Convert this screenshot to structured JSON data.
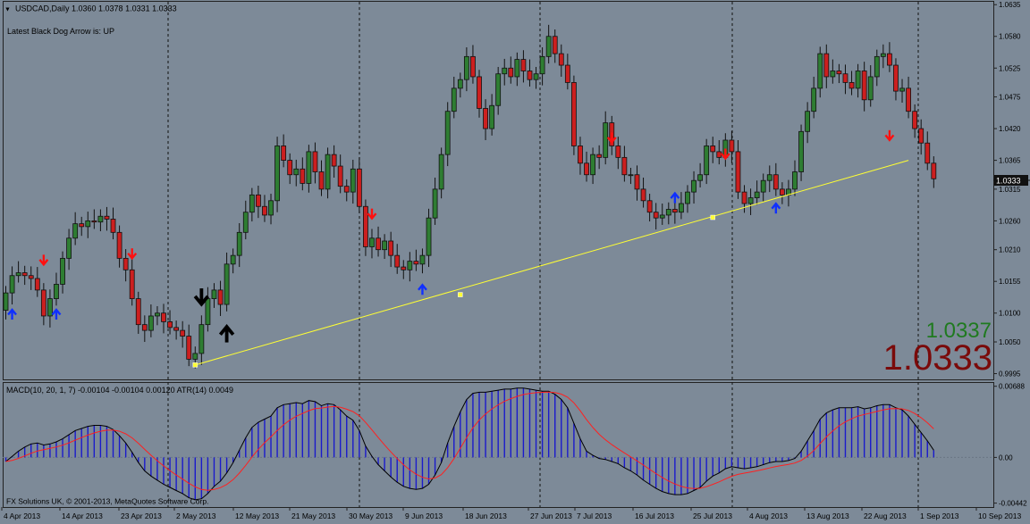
{
  "header": {
    "symbol_line": "USDCAD,Daily  1.0360 1.0378 1.0331 1.0333",
    "indicator_line": "Latest Black Dog Arrow is:  UP"
  },
  "price_display": {
    "bid": "1.0337",
    "current": "1.0333",
    "current_label": "1.0333"
  },
  "macd_header": "MACD(10, 20, 1, 7) -0.00104 -0.00104 0.00120  ATR(14) 0.0049",
  "copyright": "FX Solutions UK, © 2001-2013, MetaQuotes Software Corp.",
  "colors": {
    "background": "#7d8a98",
    "bull_candle": "#2e7d32",
    "bear_candle": "#cc1f1f",
    "macd_hist": "#1a1acc",
    "signal_line": "#ff2020",
    "trendline": "#ffff33",
    "up_arrow": "#1030ff",
    "down_arrow": "#ff1010",
    "black_arrow": "#000000"
  },
  "chart_data": {
    "type": "candlestick",
    "price_ticks": [
      "1.0635",
      "1.0580",
      "1.0525",
      "1.0475",
      "1.0420",
      "1.0365",
      "1.0315",
      "1.0260",
      "1.0210",
      "1.0155",
      "1.0100",
      "1.0050",
      "0.9995"
    ],
    "macd_ticks": [
      "0.00688",
      "0.00",
      "-0.00442"
    ],
    "date_labels": [
      "4 Apr 2013",
      "14 Apr 2013",
      "23 Apr 2013",
      "2 May 2013",
      "12 May 2013",
      "21 May 2013",
      "30 May 2013",
      "9 Jun 2013",
      "18 Jun 2013",
      "27 Jun 2013",
      "7 Jul 2013",
      "16 Jul 2013",
      "25 Jul 2013",
      "4 Aug 2013",
      "13 Aug 2013",
      "22 Aug 2013",
      "1 Sep 2013",
      "10 Sep 2013"
    ],
    "ylim": [
      0.9985,
      1.064
    ],
    "macd_ylim": [
      -0.0048,
      0.0072
    ],
    "closes": [
      1.0135,
      1.0165,
      1.017,
      1.0165,
      1.016,
      1.014,
      1.0095,
      1.0125,
      1.015,
      1.0195,
      1.023,
      1.0255,
      1.025,
      1.026,
      1.0258,
      1.0268,
      1.0263,
      1.024,
      1.0195,
      1.0175,
      1.0125,
      1.008,
      1.007,
      1.0095,
      1.01,
      1.0085,
      1.0075,
      1.007,
      1.006,
      1.002,
      1.003,
      1.008,
      1.0125,
      1.014,
      1.0115,
      1.0185,
      1.02,
      1.024,
      1.0275,
      1.0305,
      1.0285,
      1.027,
      1.0295,
      1.039,
      1.0365,
      1.034,
      1.035,
      1.0325,
      1.038,
      1.0345,
      1.0315,
      1.0375,
      1.0355,
      1.032,
      1.031,
      1.035,
      1.0285,
      1.0215,
      1.023,
      1.021,
      1.0225,
      1.02,
      1.018,
      1.0175,
      1.019,
      1.0185,
      1.02,
      1.0265,
      1.0315,
      1.0375,
      1.045,
      1.049,
      1.0505,
      1.0545,
      1.051,
      1.0455,
      1.042,
      1.046,
      1.0515,
      1.0525,
      1.051,
      1.054,
      1.052,
      1.0505,
      1.0515,
      1.0545,
      1.058,
      1.055,
      1.053,
      1.05,
      1.039,
      1.036,
      1.034,
      1.0375,
      1.037,
      1.043,
      1.039,
      1.037,
      1.034,
      1.034,
      1.0315,
      1.0295,
      1.0275,
      1.0265,
      1.027,
      1.028,
      1.0275,
      1.029,
      1.031,
      1.033,
      1.034,
      1.039,
      1.038,
      1.037,
      1.04,
      1.038,
      1.031,
      1.029,
      1.03,
      1.031,
      1.033,
      1.034,
      1.0315,
      1.0305,
      1.0315,
      1.0345,
      1.0415,
      1.045,
      1.049,
      1.055,
      1.051,
      1.052,
      1.0515,
      1.05,
      1.049,
      1.052,
      1.047,
      1.051,
      1.0545,
      1.055,
      1.053,
      1.0485,
      1.049,
      1.045,
      1.042,
      1.0395,
      1.036,
      1.0333
    ],
    "open_first": 1.0105,
    "trendline": {
      "start": {
        "index": 30,
        "price": 1.001
      },
      "end": {
        "index": 143,
        "price": 1.0365
      }
    },
    "trendline_markers": [
      {
        "index": 72,
        "price": 1.0132
      },
      {
        "index": 112,
        "price": 1.0266
      }
    ],
    "up_arrows": [
      {
        "index": 1,
        "price": 1.0098
      },
      {
        "index": 8,
        "price": 1.0098
      },
      {
        "index": 66,
        "price": 1.0141
      },
      {
        "index": 106,
        "price": 1.03
      },
      {
        "index": 122,
        "price": 1.0282
      }
    ],
    "down_arrows": [
      {
        "index": 6,
        "price": 1.0192
      },
      {
        "index": 20,
        "price": 1.0203
      },
      {
        "index": 58,
        "price": 1.0272
      },
      {
        "index": 96,
        "price": 1.0404
      },
      {
        "index": 114,
        "price": 1.0376
      },
      {
        "index": 140,
        "price": 1.0408
      }
    ],
    "black_up_arrows": [
      {
        "index": 35,
        "price": 1.0064
      }
    ],
    "black_down_arrows": [
      {
        "index": 31,
        "price": 1.0128
      }
    ],
    "macd": [
      -0.0004,
      0.0001,
      0.0006,
      0.001,
      0.0013,
      0.0014,
      0.0012,
      0.0013,
      0.0015,
      0.0018,
      0.0022,
      0.0026,
      0.0028,
      0.003,
      0.0031,
      0.0031,
      0.003,
      0.0027,
      0.0021,
      0.0014,
      0.0005,
      -0.0005,
      -0.0013,
      -0.0018,
      -0.0022,
      -0.0026,
      -0.0029,
      -0.0032,
      -0.0035,
      -0.0039,
      -0.0041,
      -0.004,
      -0.0035,
      -0.0028,
      -0.0023,
      -0.0015,
      -0.0005,
      0.0007,
      0.0019,
      0.0029,
      0.0034,
      0.0037,
      0.004,
      0.0048,
      0.0051,
      0.0052,
      0.0053,
      0.0052,
      0.0055,
      0.0054,
      0.005,
      0.0052,
      0.0051,
      0.0046,
      0.004,
      0.0036,
      0.0026,
      0.0011,
      0.0001,
      -0.0007,
      -0.0013,
      -0.0019,
      -0.0024,
      -0.0028,
      -0.003,
      -0.0031,
      -0.003,
      -0.0026,
      -0.0017,
      -0.0005,
      0.0014,
      0.003,
      0.0044,
      0.0056,
      0.0062,
      0.0063,
      0.0063,
      0.0064,
      0.0065,
      0.0066,
      0.0066,
      0.0067,
      0.0067,
      0.0066,
      0.0065,
      0.0064,
      0.0064,
      0.0061,
      0.0056,
      0.0048,
      0.0033,
      0.0018,
      0.0006,
      0.0002,
      -0.0001,
      -0.0002,
      -0.0004,
      -0.0006,
      -0.001,
      -0.0013,
      -0.0017,
      -0.0022,
      -0.0026,
      -0.003,
      -0.0033,
      -0.0035,
      -0.0036,
      -0.0036,
      -0.0035,
      -0.0032,
      -0.0029,
      -0.0023,
      -0.0018,
      -0.0015,
      -0.0011,
      -0.0009,
      -0.001,
      -0.0011,
      -0.001,
      -0.0009,
      -0.0007,
      -0.0005,
      -0.0004,
      -0.0004,
      -0.0003,
      -0.0001,
      0.0006,
      0.0016,
      0.0026,
      0.0037,
      0.0043,
      0.0046,
      0.0048,
      0.0048,
      0.0048,
      0.0049,
      0.0047,
      0.0048,
      0.005,
      0.0051,
      0.0051,
      0.0048,
      0.0046,
      0.004,
      0.0032,
      0.0024,
      0.0016,
      0.0007
    ]
  }
}
